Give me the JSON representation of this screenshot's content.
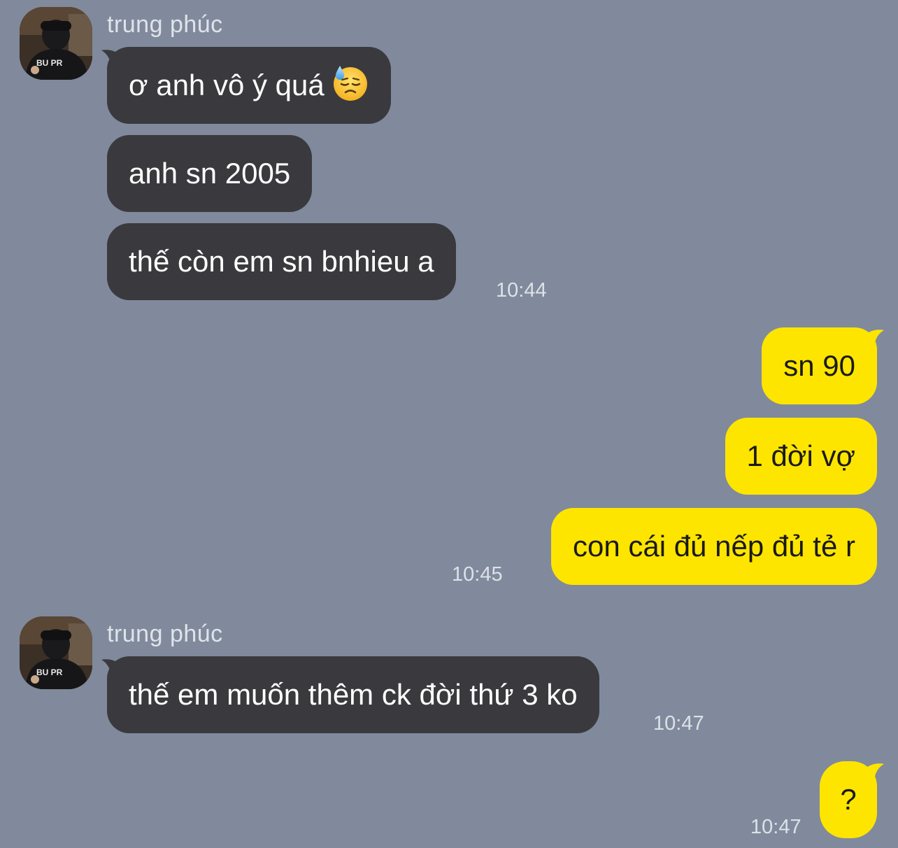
{
  "colors": {
    "background": "#808a9c",
    "incoming_bubble": "#3a3a3e",
    "outgoing_bubble": "#fee500"
  },
  "messages": [
    {
      "sender": "trung phúc",
      "direction": "incoming",
      "bubbles": [
        {
          "text": "ơ anh vô ý quá",
          "emoji": "downcast-face-with-sweat"
        },
        {
          "text": "anh sn 2005"
        },
        {
          "text": "thế còn em sn bnhieu a"
        }
      ],
      "time": "10:44"
    },
    {
      "direction": "outgoing",
      "bubbles": [
        {
          "text": "sn 90"
        },
        {
          "text": "1 đời vợ"
        },
        {
          "text": "con cái đủ nếp đủ tẻ r"
        }
      ],
      "time": "10:45"
    },
    {
      "sender": "trung phúc",
      "direction": "incoming",
      "bubbles": [
        {
          "text": "thế em muốn thêm ck đời thứ 3 ko"
        }
      ],
      "time": "10:47"
    },
    {
      "direction": "outgoing",
      "bubbles": [
        {
          "text": "?"
        }
      ],
      "time": "10:47"
    }
  ]
}
